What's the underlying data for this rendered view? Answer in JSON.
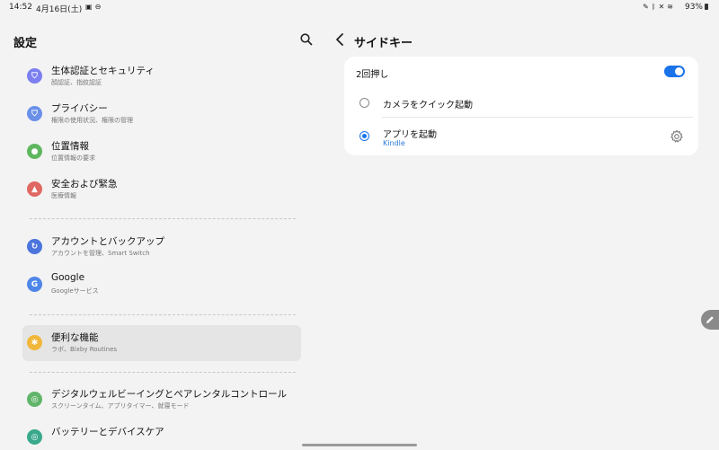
{
  "status_bar": {
    "time": "14:52",
    "date": "4月16日(土)",
    "left_icons": [
      "image-icon",
      "minus-circle-icon"
    ],
    "right_icons": [
      "pen-icon",
      "bluetooth-icon",
      "mute-icon",
      "wifi-icon"
    ],
    "battery": "93%"
  },
  "settings_panel": {
    "title": "設定",
    "search_icon": "search-icon",
    "items": [
      {
        "title": "生体認証とセキュリティ",
        "subtitle": "顔認証、指紋認証",
        "icon": "shield-icon",
        "color": "#7b7ff0"
      },
      {
        "title": "プライバシー",
        "subtitle": "権限の使用状況、権限の管理",
        "icon": "privacy-icon",
        "color": "#6a90e8"
      },
      {
        "title": "位置情報",
        "subtitle": "位置情報の要求",
        "icon": "location-pin-icon",
        "color": "#5fb760"
      },
      {
        "title": "安全および緊急",
        "subtitle": "医療情報",
        "icon": "emergency-icon",
        "color": "#e06862"
      },
      {
        "title": "アカウントとバックアップ",
        "subtitle": "アカウントを管理、Smart Switch",
        "icon": "sync-icon",
        "color": "#4b74dc"
      },
      {
        "title": "Google",
        "subtitle": "Googleサービス",
        "icon": "google-icon",
        "color": "#4f86e8"
      },
      {
        "title": "便利な機能",
        "subtitle": "ラボ、Bixby Routines",
        "icon": "advanced-features-icon",
        "color": "#f1b73a"
      },
      {
        "title": "デジタルウェルビーイングとペアレンタルコントロール",
        "subtitle": "スクリーンタイム、アプリタイマー、就寝モード",
        "icon": "wellbeing-icon",
        "color": "#61b56a"
      },
      {
        "title": "バッテリーとデバイスケア",
        "subtitle": "",
        "icon": "device-care-icon",
        "color": "#3aa98b"
      }
    ]
  },
  "side_key": {
    "title": "サイドキー",
    "back_icon": "back-arrow-icon",
    "double_press": {
      "label": "2回押し",
      "enabled": true
    },
    "options": [
      {
        "label": "カメラをクイック起動",
        "selected": false
      },
      {
        "label": "アプリを起動",
        "subtitle": "Kindle",
        "selected": true
      }
    ],
    "settings_icon": "gear-icon"
  },
  "colors": {
    "accent": "#1a73e8",
    "background": "#f3f3f3",
    "selected_item": "#e5e5e5"
  }
}
